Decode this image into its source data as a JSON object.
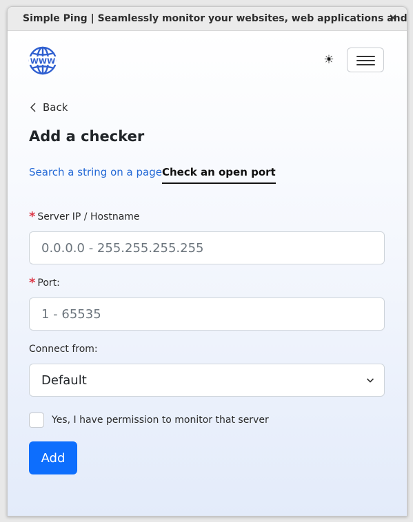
{
  "window": {
    "title": "Simple Ping | Seamlessly monitor your websites, web applications and servers",
    "close_glyph": "✕"
  },
  "header": {
    "logo_icon": "www-globe-icon",
    "logo_text": "WWW",
    "theme_toggle_icon": "sun-icon",
    "theme_toggle_glyph": "☀",
    "menu_icon": "hamburger-icon"
  },
  "nav": {
    "back_label": "Back"
  },
  "page": {
    "title": "Add a checker"
  },
  "tabs": [
    {
      "label": "Search a string on a page",
      "active": false
    },
    {
      "label": "Check an open port",
      "active": true
    }
  ],
  "form": {
    "required_mark": "*",
    "server": {
      "label": "Server IP / Hostname",
      "placeholder": "0.0.0.0 - 255.255.255.255",
      "value": ""
    },
    "port": {
      "label": "Port:",
      "placeholder": "1 - 65535",
      "value": ""
    },
    "connect_from": {
      "label": "Connect from:",
      "selected": "Default"
    },
    "permission": {
      "label": "Yes, I have permission to monitor that server",
      "checked": false
    },
    "submit_label": "Add"
  },
  "colors": {
    "accent": "#0d6efd",
    "link": "#2469d6",
    "required": "#dc3545",
    "logo": "#2f5fd0"
  }
}
